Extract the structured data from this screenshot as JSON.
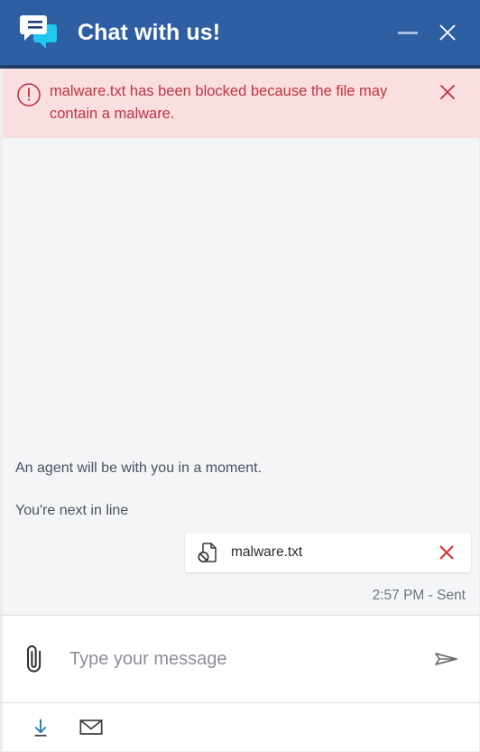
{
  "window": {
    "title": "Chat with us!",
    "app_icon": "chat-bubbles-icon",
    "minimize_label": "Minimize",
    "close_label": "Close",
    "header_color": "#2f5fa3",
    "header_accent_color": "#1f3f6e"
  },
  "alert": {
    "icon": "exclamation-circle-icon",
    "message": "malware.txt has been blocked because the file may contain a malware.",
    "close_label": "Dismiss",
    "background_color": "#fadfe1",
    "text_color": "#c0343f"
  },
  "chat": {
    "messages": [
      {
        "text": "An agent will be with you in a moment."
      },
      {
        "text": "You're next in line"
      }
    ],
    "attachment": {
      "icon": "blocked-document-icon",
      "filename": "malware.txt",
      "remove_label": "Remove",
      "remove_color": "#e02a2a"
    },
    "status": "2:57 PM - Sent"
  },
  "composer": {
    "attach_icon": "paperclip-icon",
    "placeholder": "Type your message",
    "value": "",
    "send_icon": "send-plane-icon"
  },
  "toolbar": {
    "items": [
      {
        "icon": "download-icon",
        "label": "Download transcript",
        "color": "#1f7ba8"
      },
      {
        "icon": "envelope-icon",
        "label": "Email transcript",
        "color": "#3c3c3c"
      }
    ]
  }
}
